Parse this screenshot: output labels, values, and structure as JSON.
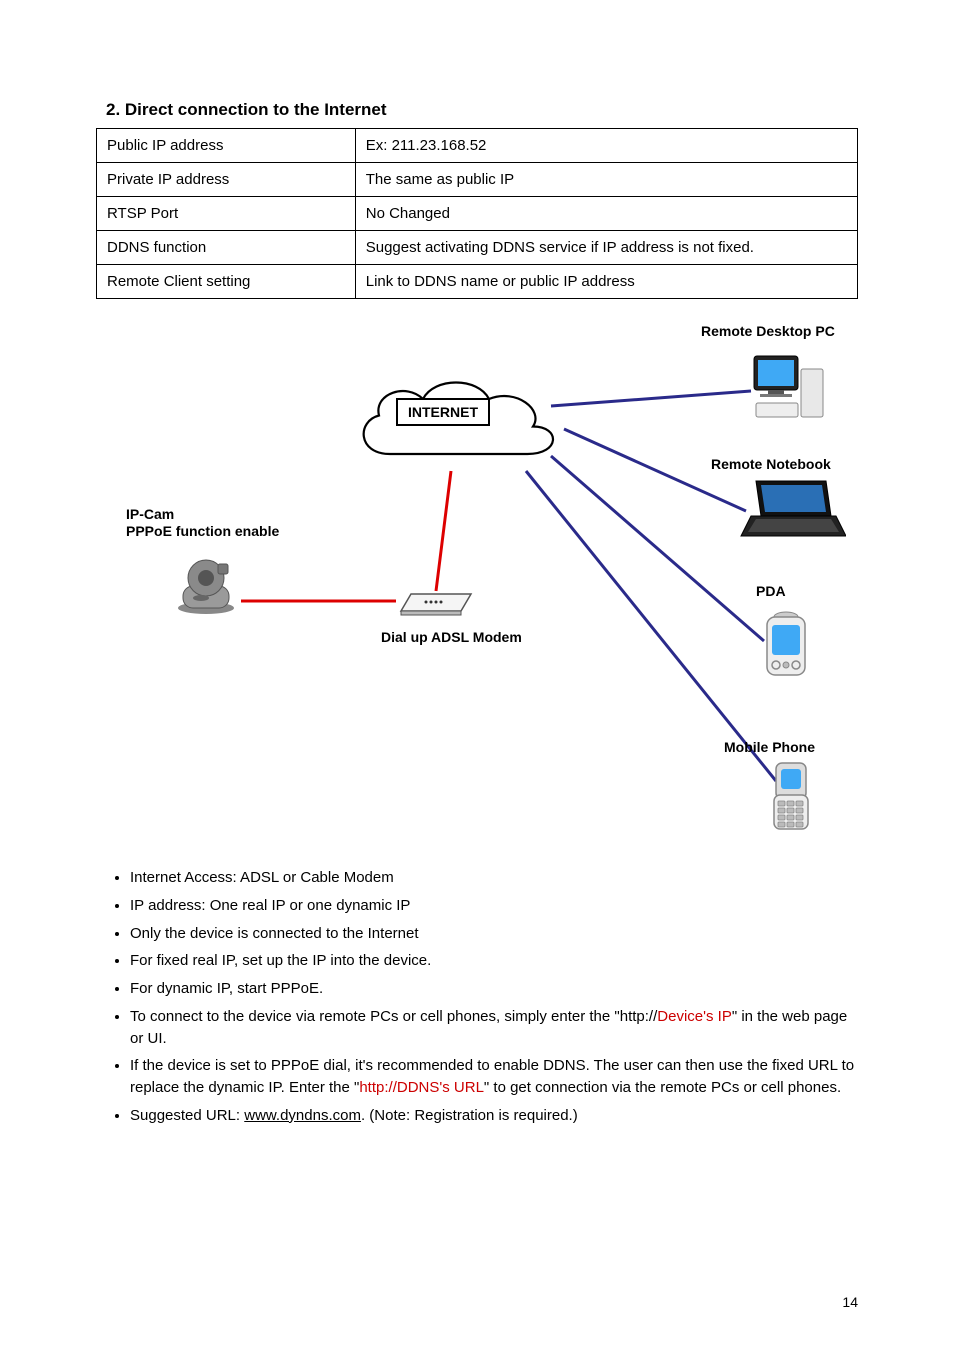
{
  "heading": "2. Direct connection to the Internet",
  "table": {
    "rows": [
      [
        "Public IP address",
        "Ex: 211.23.168.52"
      ],
      [
        "Private IP address",
        "The same as public IP"
      ],
      [
        "RTSP Port",
        "No Changed"
      ],
      [
        "DDNS function",
        "Suggest activating DDNS service if IP address is not fixed."
      ],
      [
        "Remote Client setting",
        "Link to DDNS name or public IP address"
      ]
    ]
  },
  "diagram": {
    "remote_desktop": "Remote Desktop PC",
    "remote_notebook": "Remote Notebook",
    "pda": "PDA",
    "mobile_phone": "Mobile Phone",
    "internet": "INTERNET",
    "ipcam_line1": "IP-Cam",
    "ipcam_line2": "PPPoE function enable",
    "modem": "Dial up ADSL Modem"
  },
  "bullets": [
    "Internet Access: ADSL or Cable Modem",
    "IP address: One real IP or one dynamic IP",
    "Only the device is connected to the Internet",
    "For fixed real IP, set up the IP into the device.",
    "For dynamic IP, start PPPoE.",
    "To connect to the device via remote PCs or cell phones, simply enter the \"http://\" in the web page or UI.",
    "If the device is set to PPPoE dial, it's recommended to enable DDNS. The user can then use the fixed URL to replace the dynamic IP. Enter the \"\" to get connection via the remote PCs or cell phones.",
    "Suggested URL: . (Note: Registration is required.)"
  ],
  "bullet6_prefix": "To connect to the device via remote PCs or cell phones, simply enter the \"http://",
  "bullet6_insert": "Device's IP",
  "bullet6_suffix": "\" in the web page or UI.",
  "bullet7_prefix": "If the device is set to PPPoE dial, it's recommended to enable DDNS. The user can then use the fixed URL to replace the dynamic IP. Enter the \"",
  "bullet7_insert": "http://DDNS's URL",
  "bullet7_suffix": "\" to get connection via the remote PCs or cell phones.",
  "bullet8_prefix": "Suggested URL: ",
  "bullet8_link": "www.dyndns.com",
  "bullet8_suffix": ". (Note: Registration is required.)",
  "page_num": "14"
}
